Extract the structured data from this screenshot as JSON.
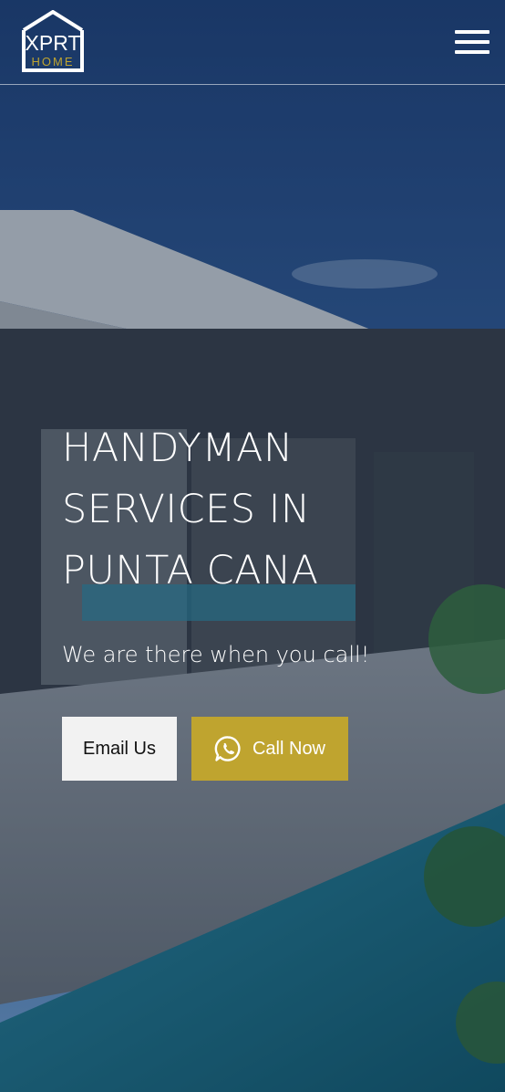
{
  "header": {
    "logo": {
      "top": "XPRT",
      "bottom": "HOME"
    },
    "menu_icon": "hamburger-menu-icon"
  },
  "hero": {
    "title_lines": [
      "HANDYMAN",
      "SERVICES IN",
      "PUNTA CANA"
    ],
    "tagline": "We are there when you call!",
    "email_button": "Email Us",
    "call_button": "Call Now",
    "call_icon": "whatsapp-icon"
  },
  "colors": {
    "accent": "#bfa42f",
    "email_button_bg": "#f2f2f2",
    "text": "#ffffff"
  }
}
